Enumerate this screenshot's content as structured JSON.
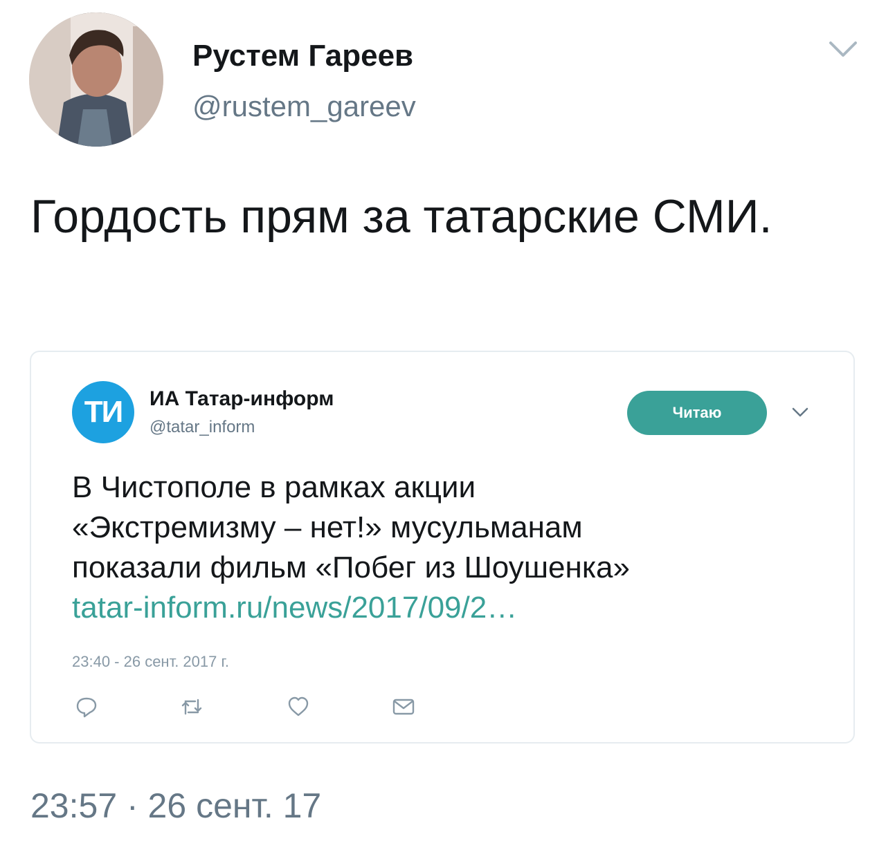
{
  "author": {
    "name": "Рустем Гареев",
    "handle": "@rustem_gareev",
    "avatar_icon": "profile-photo"
  },
  "tweet": {
    "text": "Гордость прям за татарские СМИ.",
    "timestamp": "23:57 · 26 сент. 17"
  },
  "quoted": {
    "logo_text": "ТИ",
    "name": "ИА Татар-информ",
    "handle": "@tatar_inform",
    "follow_label": "Читаю",
    "text_line1": "В Чистополе в рамках акции",
    "text_line2": "«Экстремизму – нет!» мусульманам",
    "text_line3": "показали фильм «Побег из Шоушенка»",
    "link": "tatar-inform.ru/news/2017/09/2…",
    "time": "23:40 - 26 сент. 2017 г.",
    "actions": [
      "reply-icon",
      "retweet-icon",
      "like-icon",
      "message-icon"
    ]
  },
  "colors": {
    "accent": "#3aa198",
    "logo_blue": "#1da1e0",
    "secondary_text": "#657786"
  }
}
